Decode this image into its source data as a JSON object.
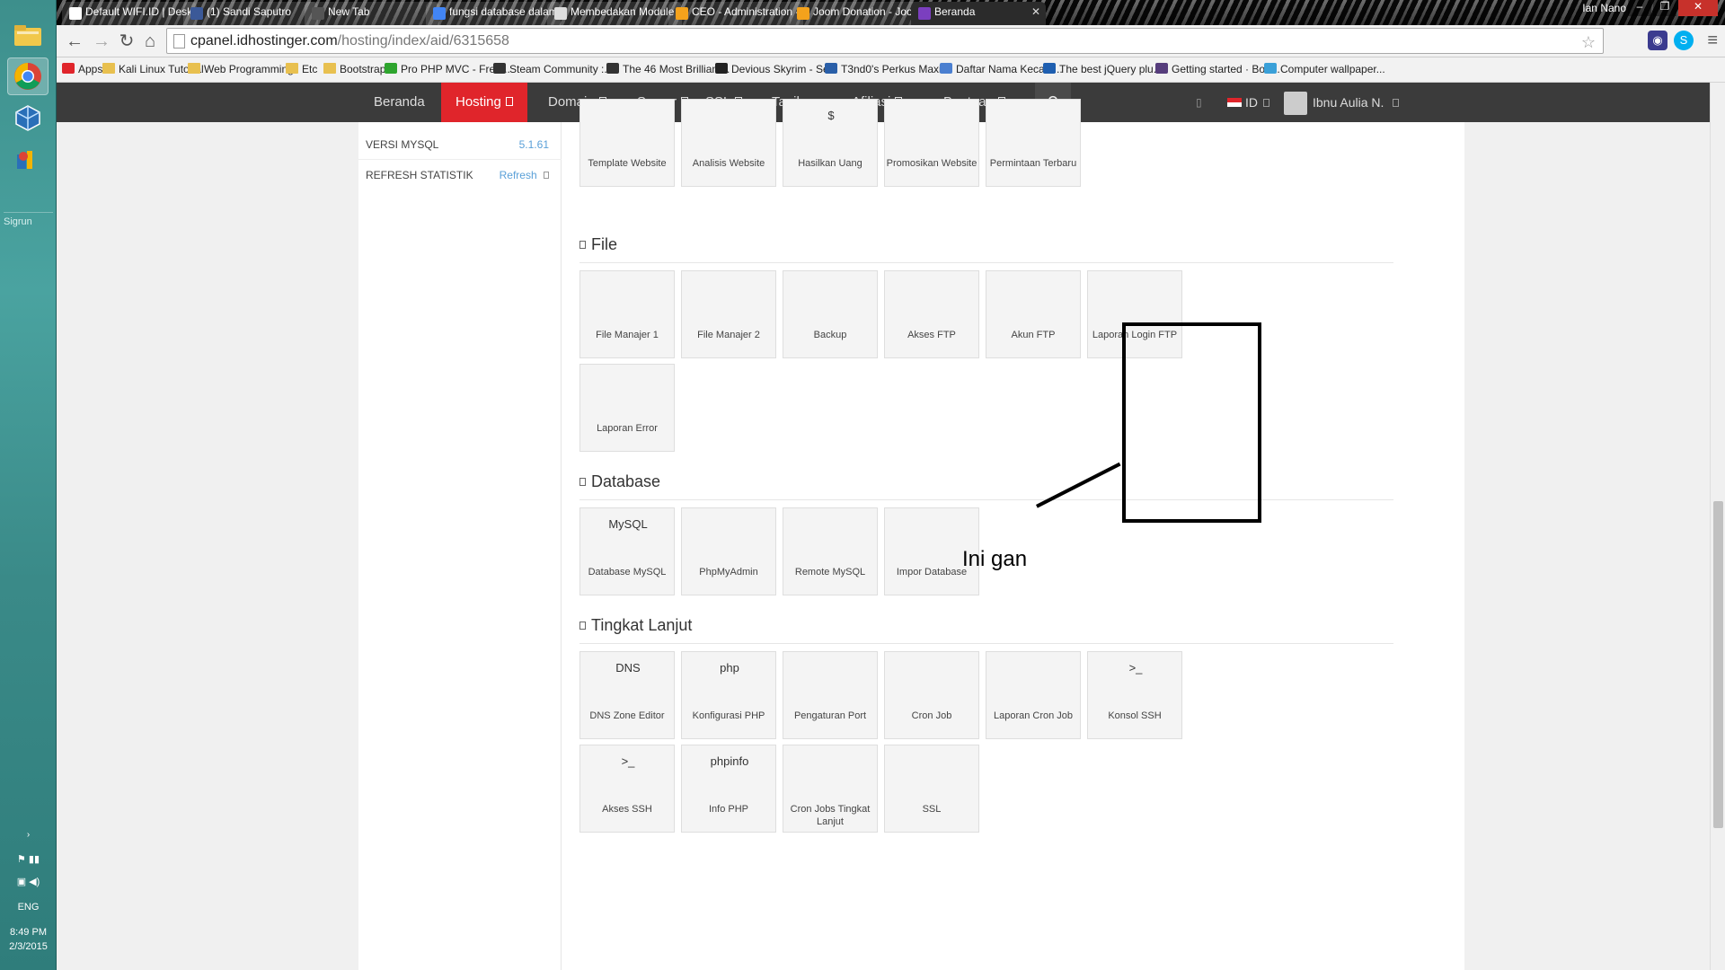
{
  "taskbar": {
    "search_label": "Sigrun",
    "language": "ENG",
    "time": "8:49 PM",
    "date": "2/3/2015"
  },
  "browser": {
    "profile_name": "Ian Nano",
    "tabs": [
      {
        "title": "Default WIFI.ID | Desktop",
        "fav_color": "#ffffff"
      },
      {
        "title": "(1) Sandi Saputro",
        "fav_color": "#3b5998"
      },
      {
        "title": "New Tab",
        "fav_color": "#555555"
      },
      {
        "title": "fungsi database dalam jo",
        "fav_color": "#4285f4"
      },
      {
        "title": "Membedakan Module da",
        "fav_color": "#dddddd"
      },
      {
        "title": "CEO - Administration - C",
        "fav_color": "#f4a21c"
      },
      {
        "title": "Joom Donation - Joomla!",
        "fav_color": "#f4a21c"
      },
      {
        "title": "Beranda",
        "fav_color": "#7b3fbf"
      }
    ],
    "url_host": "cpanel.idhostinger.com",
    "url_path": "/hosting/index/aid/6315658",
    "bookmarks": [
      {
        "label": "Apps",
        "color": "#e0252b"
      },
      {
        "label": "Kali Linux Tutorial",
        "color": "#e8c04f"
      },
      {
        "label": "Web Programming",
        "color": "#e8c04f"
      },
      {
        "label": "Etc",
        "color": "#e8c04f"
      },
      {
        "label": "Bootstrap",
        "color": "#e8c04f"
      },
      {
        "label": "Pro PHP MVC - Free...",
        "color": "#2ea52e"
      },
      {
        "label": "Steam Community :...",
        "color": "#333333"
      },
      {
        "label": "The 46 Most Brilliant...",
        "color": "#333333"
      },
      {
        "label": "Devious Skyrim - Se...",
        "color": "#222222"
      },
      {
        "label": "T3nd0's Perkus Maxi...",
        "color": "#2a5fa8"
      },
      {
        "label": "Daftar Nama Kecam...",
        "color": "#4a7fd0"
      },
      {
        "label": "The best jQuery plu...",
        "color": "#1f5fb0"
      },
      {
        "label": "Getting started · Boo...",
        "color": "#563d7c"
      },
      {
        "label": "Computer wallpaper...",
        "color": "#3aa0d8"
      }
    ]
  },
  "topnav": {
    "items": [
      "Beranda",
      "Hosting",
      "Domain",
      "Server",
      "SSL",
      "Tagihan",
      "Afiliasi",
      "Bantuan"
    ],
    "active": "Hosting",
    "language": "ID",
    "user": "Ibnu Aulia N."
  },
  "sidebar": {
    "mysql_label": "VERSI MYSQL",
    "mysql_value": "5.1.61",
    "refresh_label": "REFRESH STATISTIK",
    "refresh_link": "Refresh"
  },
  "sections": {
    "top_tiles": [
      "Template Website",
      "Analisis Website",
      "Hasilkan Uang",
      "Promosikan Website",
      "Permintaan Terbaru"
    ],
    "file": {
      "title": "File",
      "tiles": [
        "File Manajer 1",
        "File Manajer 2",
        "Backup",
        "Akses FTP",
        "Akun FTP",
        "Laporan Login FTP",
        "Laporan Error"
      ]
    },
    "database": {
      "title": "Database",
      "tiles": [
        "Database MySQL",
        "PhpMyAdmin",
        "Remote MySQL",
        "Impor Database"
      ]
    },
    "advanced": {
      "title": "Tingkat Lanjut",
      "tiles": [
        "DNS Zone Editor",
        "Konfigurasi PHP",
        "Pengaturan Port",
        "Cron Job",
        "Laporan Cron Job",
        "Konsol SSH",
        "Akses SSH",
        "Info PHP",
        "Cron Jobs Tingkat Lanjut",
        "SSL"
      ]
    }
  },
  "annotation": {
    "text": "Ini gan"
  },
  "icon_text": {
    "mysql": "MySQL",
    "dns": "DNS",
    "php": "php",
    "php_info": "info"
  },
  "colors": {
    "accent_red": "#e0252b",
    "nav_dark": "#3b3b3b",
    "link_blue": "#5aa0d8"
  }
}
